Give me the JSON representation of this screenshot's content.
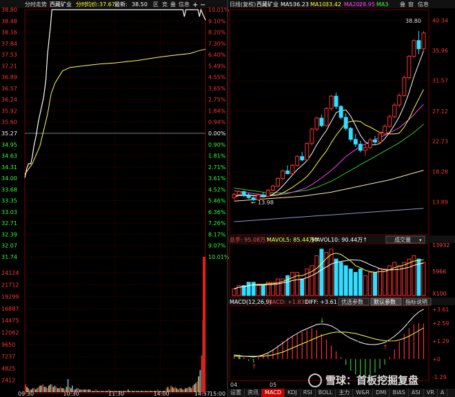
{
  "intraday": {
    "header": {
      "title": "分时走势",
      "stock": "西藏矿业",
      "mode": "分时",
      "avg_label": "均价:",
      "avg": "37.67",
      "last_label": "最新:",
      "last": "38.50",
      "buttons": [
        "区",
        "竞",
        "叠",
        "信息"
      ]
    },
    "price_ticks": [
      "38.80",
      "38.48",
      "38.16",
      "37.84",
      "37.53",
      "37.21",
      "36.89",
      "36.57",
      "36.24",
      "35.92",
      "35.60",
      "35.27",
      "34.95",
      "34.63",
      "34.31",
      "34.00",
      "33.68",
      "33.35",
      "33.03",
      "32.71",
      "32.39",
      "32.07",
      "31.74"
    ],
    "pct_ticks": [
      "10.01%",
      "9.10%",
      "8.20%",
      "7.30%",
      "6.40%",
      "5.49%",
      "4.55%",
      "3.65%",
      "2.75%",
      "1.84%",
      "0.94%",
      "0.00%",
      "0.90%",
      "1.81%",
      "2.71%",
      "3.61%",
      "4.52%",
      "5.46%",
      "6.36%",
      "7.26%",
      "8.17%",
      "9.07%",
      "10.01%"
    ],
    "vol_ticks": [
      "24124",
      "21712",
      "19299",
      "16887",
      "14475",
      "12062",
      "9650",
      "7237",
      "4825",
      "2412"
    ],
    "time_ticks": [
      "09:30",
      "10:30",
      "11:30",
      "14:00",
      "14:57",
      "15:00"
    ],
    "prev_close": 35.27,
    "price_range": [
      31.74,
      38.8
    ],
    "price_series": [
      [
        0,
        34.0
      ],
      [
        3,
        34.3
      ],
      [
        5,
        34.4
      ],
      [
        8,
        34.4
      ],
      [
        10,
        34.6
      ],
      [
        12,
        34.9
      ],
      [
        15,
        35.2
      ],
      [
        18,
        35.6
      ],
      [
        20,
        35.8
      ],
      [
        22,
        36.0
      ],
      [
        25,
        36.3
      ],
      [
        28,
        36.8
      ],
      [
        30,
        37.5
      ],
      [
        32,
        37.9
      ],
      [
        34,
        38.3
      ],
      [
        36,
        38.8
      ],
      [
        40,
        38.8
      ],
      [
        60,
        38.8
      ],
      [
        100,
        38.8
      ],
      [
        120,
        38.8
      ],
      [
        150,
        38.8
      ],
      [
        180,
        38.8
      ],
      [
        210,
        38.8
      ],
      [
        212,
        38.6
      ],
      [
        214,
        38.8
      ],
      [
        230,
        38.8
      ],
      [
        232,
        38.6
      ],
      [
        234,
        38.8
      ],
      [
        236,
        38.7
      ],
      [
        238,
        38.6
      ],
      [
        240,
        38.5
      ]
    ],
    "avg_series": [
      [
        0,
        34.1
      ],
      [
        10,
        34.4
      ],
      [
        20,
        34.9
      ],
      [
        30,
        35.8
      ],
      [
        35,
        36.4
      ],
      [
        40,
        36.7
      ],
      [
        50,
        37.05
      ],
      [
        60,
        37.15
      ],
      [
        80,
        37.2
      ],
      [
        100,
        37.25
      ],
      [
        120,
        37.28
      ],
      [
        150,
        37.35
      ],
      [
        180,
        37.45
      ],
      [
        200,
        37.5
      ],
      [
        220,
        37.55
      ],
      [
        230,
        37.62
      ],
      [
        240,
        37.67
      ]
    ],
    "volumes": [
      6,
      4,
      3,
      2,
      2,
      3,
      3,
      2,
      3,
      4,
      5,
      5,
      6,
      4,
      4,
      3,
      5,
      6,
      6,
      4,
      5,
      4,
      3,
      3,
      4,
      3,
      3,
      2,
      4,
      10,
      4,
      3,
      5,
      2,
      2,
      3,
      3,
      2,
      2,
      2,
      2,
      2,
      2,
      2,
      2,
      1,
      1,
      1,
      2,
      1,
      1,
      1,
      1,
      1,
      1,
      1,
      1,
      2,
      1,
      1,
      1,
      1,
      1,
      1,
      1,
      1,
      1,
      1,
      1,
      1,
      2,
      1,
      1,
      1,
      1,
      1,
      1,
      1,
      1,
      1,
      1,
      1,
      1,
      1,
      1,
      1,
      1,
      1,
      1,
      1,
      2,
      1,
      1,
      1,
      1,
      1,
      3,
      4,
      2,
      5,
      4,
      3,
      4,
      3,
      2,
      3,
      3,
      2,
      2,
      3,
      3,
      4,
      4,
      3,
      5,
      6,
      7,
      8,
      12,
      17,
      28,
      55,
      99
    ]
  },
  "daily": {
    "header": {
      "title": "日线(复权)",
      "stock": "西藏矿业",
      "ma5_label": "MA5:",
      "ma5": "36.23",
      "ma10_label": "MA10:",
      "ma10": "33.42",
      "ma20_label": "MA20:",
      "ma20": "28.95",
      "ma30_label": "MA3",
      "buttons": [
        "叠",
        "窗",
        "信息"
      ]
    },
    "price_ticks": [
      "40.34",
      "35.96",
      "31.57",
      "27.12",
      "22.73",
      "18.28",
      "13.89"
    ],
    "high_label": "38.80",
    "low_label": "13.98",
    "candles": [
      [
        14.5,
        15.2,
        14.2,
        15.0
      ],
      [
        15.0,
        15.6,
        14.8,
        15.4
      ],
      [
        15.4,
        15.5,
        14.6,
        14.8
      ],
      [
        14.8,
        15.2,
        14.3,
        14.5
      ],
      [
        14.5,
        14.7,
        13.98,
        14.2
      ],
      [
        14.2,
        15.1,
        14.1,
        14.9
      ],
      [
        14.9,
        15.3,
        14.6,
        14.7
      ],
      [
        14.7,
        15.8,
        14.6,
        15.6
      ],
      [
        15.6,
        16.4,
        15.4,
        16.2
      ],
      [
        16.2,
        17.5,
        16.0,
        17.3
      ],
      [
        17.3,
        18.6,
        17.0,
        18.4
      ],
      [
        18.4,
        19.2,
        17.9,
        18.0
      ],
      [
        18.0,
        19.4,
        17.8,
        19.2
      ],
      [
        19.2,
        20.7,
        19.0,
        20.5
      ],
      [
        20.5,
        21.2,
        19.8,
        20.0
      ],
      [
        20.0,
        22.6,
        19.9,
        22.4
      ],
      [
        22.4,
        24.7,
        22.1,
        24.5
      ],
      [
        24.5,
        26.3,
        24.2,
        26.1
      ],
      [
        26.1,
        26.6,
        24.8,
        25.0
      ],
      [
        25.0,
        27.7,
        24.9,
        27.5
      ],
      [
        27.5,
        29.5,
        27.2,
        29.3
      ],
      [
        29.3,
        29.8,
        27.4,
        27.8
      ],
      [
        27.8,
        28.0,
        25.9,
        26.2
      ],
      [
        26.2,
        26.8,
        24.3,
        24.6
      ],
      [
        24.6,
        24.8,
        22.7,
        23.0
      ],
      [
        23.0,
        23.8,
        21.9,
        22.3
      ],
      [
        22.3,
        22.8,
        21.1,
        21.4
      ],
      [
        21.4,
        22.3,
        20.6,
        21.8
      ],
      [
        21.8,
        23.2,
        21.6,
        22.9
      ],
      [
        22.9,
        23.5,
        22.2,
        22.6
      ],
      [
        22.6,
        24.1,
        22.4,
        23.8
      ],
      [
        23.8,
        25.2,
        23.6,
        24.9
      ],
      [
        24.9,
        26.6,
        24.7,
        26.3
      ],
      [
        26.3,
        28.3,
        26.1,
        28.0
      ],
      [
        28.0,
        29.7,
        27.7,
        29.4
      ],
      [
        29.4,
        32.3,
        29.2,
        32.0
      ],
      [
        32.0,
        35.3,
        31.7,
        35.1
      ],
      [
        35.1,
        37.6,
        34.9,
        37.4
      ],
      [
        37.4,
        38.8,
        35.4,
        36.2
      ],
      [
        36.2,
        38.8,
        35.8,
        38.5
      ]
    ],
    "ma5": [
      14.6,
      14.8,
      14.9,
      14.9,
      14.8,
      14.7,
      14.6,
      14.7,
      15.0,
      15.5,
      16.2,
      17.0,
      17.8,
      18.6,
      19.2,
      19.9,
      20.9,
      22.2,
      23.3,
      24.3,
      25.6,
      26.9,
      27.2,
      27.3,
      26.4,
      25.0,
      23.6,
      22.6,
      22.2,
      22.2,
      22.4,
      23.1,
      24.0,
      25.1,
      26.3,
      27.9,
      29.8,
      32.1,
      34.0,
      35.9
    ],
    "ma10": [
      14.8,
      14.8,
      14.8,
      14.8,
      14.8,
      14.8,
      14.8,
      14.8,
      14.8,
      14.9,
      15.2,
      15.6,
      16.0,
      16.5,
      17.0,
      17.6,
      18.4,
      19.4,
      20.4,
      21.3,
      22.5,
      23.6,
      24.5,
      25.4,
      25.6,
      25.7,
      25.6,
      25.1,
      24.8,
      24.4,
      24.0,
      24.0,
      23.8,
      23.8,
      23.9,
      24.8,
      26.0,
      27.5,
      28.9,
      30.3
    ],
    "ma20": [
      15.5,
      15.4,
      15.3,
      15.2,
      15.1,
      15.0,
      14.9,
      14.9,
      14.9,
      14.9,
      15.0,
      15.1,
      15.3,
      15.5,
      15.7,
      16.0,
      16.4,
      16.9,
      17.4,
      17.9,
      18.5,
      19.1,
      19.8,
      20.5,
      21.0,
      21.5,
      22.0,
      22.3,
      22.7,
      23.0,
      23.3,
      23.6,
      24.0,
      24.3,
      24.7,
      25.3,
      25.9,
      26.6,
      27.4,
      28.1
    ],
    "ma30": [
      15.9,
      15.8,
      15.7,
      15.6,
      15.5,
      15.4,
      15.3,
      15.2,
      15.2,
      15.2,
      15.2,
      15.2,
      15.3,
      15.4,
      15.5,
      15.6,
      15.8,
      16.0,
      16.3,
      16.6,
      16.9,
      17.3,
      17.7,
      18.1,
      18.5,
      18.9,
      19.3,
      19.7,
      20.1,
      20.5,
      20.9,
      21.3,
      21.7,
      22.1,
      22.5,
      23.0,
      23.5,
      24.0,
      24.6,
      25.2
    ],
    "ma60": [
      14.0,
      14.05,
      14.1,
      14.15,
      14.2,
      14.25,
      14.3,
      14.35,
      14.4,
      14.45,
      14.5,
      14.55,
      14.6,
      14.65,
      14.7,
      14.8,
      14.9,
      15.0,
      15.1,
      15.2,
      15.3,
      15.45,
      15.6,
      15.75,
      15.9,
      16.05,
      16.2,
      16.35,
      16.5,
      16.65,
      16.8,
      16.95,
      17.1,
      17.3,
      17.5,
      17.7,
      17.9,
      18.1,
      18.3,
      18.5
    ],
    "ma120": [
      11.0,
      11.05,
      11.1,
      11.15,
      11.2,
      11.25,
      11.3,
      11.35,
      11.4,
      11.45,
      11.5,
      11.55,
      11.6,
      11.65,
      11.7,
      11.75,
      11.8,
      11.85,
      11.9,
      11.95,
      12.0,
      12.05,
      12.1,
      12.15,
      12.2,
      12.25,
      12.3,
      12.35,
      12.4,
      12.45,
      12.5,
      12.55,
      12.6,
      12.65,
      12.7,
      12.75,
      12.8,
      12.85,
      12.9,
      12.95
    ]
  },
  "volume": {
    "header": {
      "label": "总手: 95.08万↑",
      "mavol5": "MAVOL5: 85.44万↑",
      "mavol10": "MAVOL10: 90.44万↑",
      "selector": "成交量"
    },
    "ticks": [
      "13932",
      "5966",
      "X100"
    ],
    "bars": [
      2,
      3,
      3,
      4,
      4,
      3,
      3,
      4,
      4,
      5,
      5,
      6,
      7,
      7,
      5,
      8,
      9,
      12,
      14,
      13,
      14,
      11,
      10,
      9,
      8,
      7,
      8,
      6,
      7,
      7,
      8,
      8,
      9,
      10,
      9,
      10,
      11,
      12,
      11,
      10
    ]
  },
  "macd": {
    "header": {
      "params": "MACD(12,26,9)",
      "macd": "MACD: +1.831",
      "diff": "DIFF: +3.61↑",
      "buttons": [
        "优选参数",
        "默认参数",
        "指标说明"
      ]
    },
    "ticks": [
      "+3.61",
      "+2.59",
      "+1.29",
      "+0",
      "-1.29"
    ],
    "hist": [
      0.2,
      0.2,
      0.1,
      -0.1,
      -0.2,
      0.1,
      0.2,
      0.3,
      0.5,
      0.7,
      0.9,
      1.1,
      1.2,
      1.3,
      1.4,
      1.5,
      1.6,
      1.5,
      1.3,
      1.0,
      0.7,
      0.4,
      0.1,
      -0.3,
      -0.6,
      -0.8,
      -0.9,
      -1.0,
      -0.9,
      -0.7,
      -0.5,
      -0.3,
      0.1,
      0.5,
      0.9,
      1.3,
      1.6,
      1.8,
      1.85,
      1.83
    ],
    "diff": [
      0.3,
      0.25,
      0.2,
      0.18,
      0.15,
      0.2,
      0.3,
      0.45,
      0.65,
      0.9,
      1.15,
      1.4,
      1.65,
      1.85,
      2.05,
      2.2,
      2.35,
      2.5,
      2.55,
      2.5,
      2.4,
      2.2,
      1.95,
      1.7,
      1.5,
      1.35,
      1.2,
      1.1,
      1.05,
      1.05,
      1.1,
      1.2,
      1.4,
      1.65,
      1.95,
      2.3,
      2.7,
      3.1,
      3.4,
      3.61
    ],
    "dea": [
      0.2,
      0.2,
      0.2,
      0.2,
      0.2,
      0.2,
      0.2,
      0.25,
      0.3,
      0.4,
      0.5,
      0.65,
      0.8,
      0.95,
      1.1,
      1.25,
      1.4,
      1.55,
      1.7,
      1.8,
      1.9,
      1.95,
      1.95,
      1.95,
      1.9,
      1.85,
      1.75,
      1.65,
      1.55,
      1.45,
      1.38,
      1.33,
      1.3,
      1.32,
      1.38,
      1.5,
      1.65,
      1.85,
      2.05,
      2.25
    ],
    "date_ticks": [
      "04",
      "05"
    ]
  },
  "tabs": [
    "设置",
    "资讯",
    "MACD",
    "KDJ",
    "RSI",
    "BOLL",
    "主力",
    "W&R",
    "DMI",
    "BIAS",
    "ASI",
    "VR",
    "A"
  ],
  "watermark": "雪球：首板挖掘复盘",
  "colors": {
    "up": "#ff3333",
    "down": "#33ddff",
    "grid": "#7a0000",
    "price": "#ffffff",
    "avg": "#ffff66"
  }
}
